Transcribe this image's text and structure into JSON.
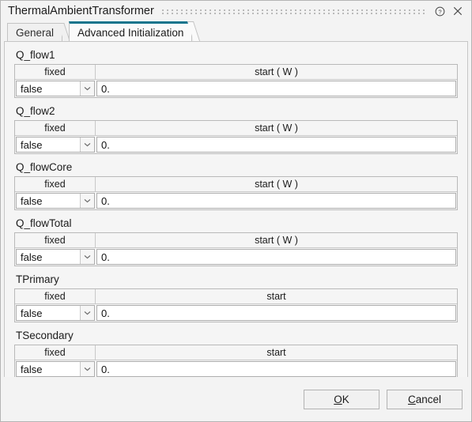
{
  "window": {
    "title": "ThermalAmbientTransformer",
    "help_icon": "help-circle-icon",
    "close_icon": "close-icon"
  },
  "tabs": [
    {
      "label": "General",
      "active": false
    },
    {
      "label": "Advanced Initialization",
      "active": true
    }
  ],
  "columns": {
    "fixed": "fixed",
    "start": "start",
    "start_watt_base": "start",
    "start_watt_unit": "( W )"
  },
  "groups": [
    {
      "name": "Q_flow1",
      "fixed_value": "false",
      "start_header": "start",
      "start_unit": "( W )",
      "start_value": "0."
    },
    {
      "name": "Q_flow2",
      "fixed_value": "false",
      "start_header": "start",
      "start_unit": "( W )",
      "start_value": "0."
    },
    {
      "name": "Q_flowCore",
      "fixed_value": "false",
      "start_header": "start",
      "start_unit": "( W )",
      "start_value": "0."
    },
    {
      "name": "Q_flowTotal",
      "fixed_value": "false",
      "start_header": "start",
      "start_unit": "( W )",
      "start_value": "0."
    },
    {
      "name": "TPrimary",
      "fixed_value": "false",
      "start_header": "start",
      "start_unit": "",
      "start_value": "0."
    },
    {
      "name": "TSecondary",
      "fixed_value": "false",
      "start_header": "start",
      "start_unit": "",
      "start_value": "0."
    }
  ],
  "dropdown_options": [
    "false",
    "true"
  ],
  "footer": {
    "ok_mnemonic": "O",
    "ok_rest": "K",
    "cancel_mnemonic": "C",
    "cancel_rest": "ancel"
  },
  "colors": {
    "accent_tab": "#12748c",
    "window_bg": "#f3f3f3",
    "panel_bg": "#f5f5f5",
    "field_bg": "#ffffff",
    "border": "#b9b9b9",
    "text": "#1b1b1b"
  }
}
